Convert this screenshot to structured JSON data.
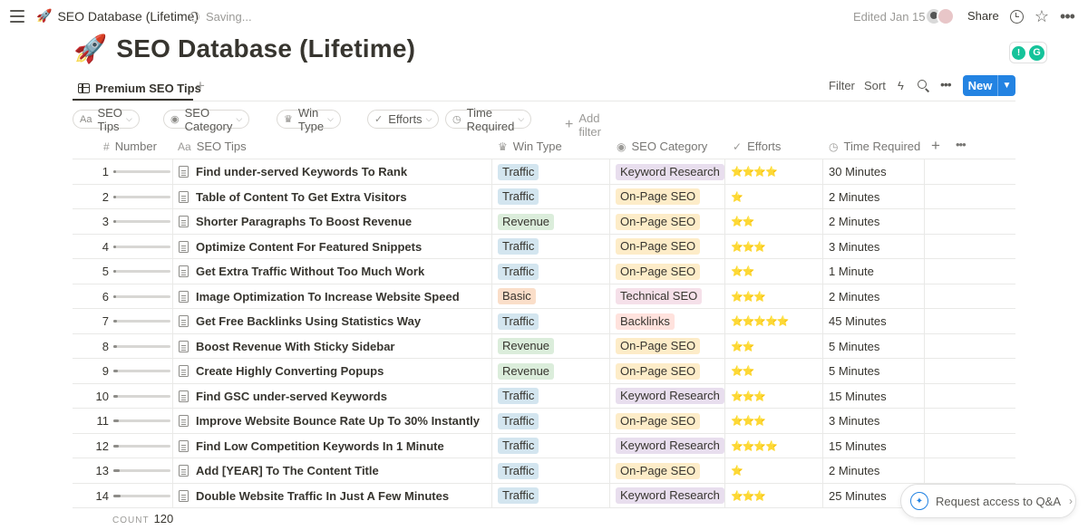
{
  "topbar": {
    "page_emoji": "🚀",
    "breadcrumb": "SEO Database (Lifetime)",
    "saving": "Saving...",
    "edited": "Edited Jan 15",
    "share": "Share"
  },
  "page": {
    "emoji": "🚀",
    "title": "SEO Database (Lifetime)"
  },
  "views": {
    "active_tab": "Premium SEO Tips",
    "filter": "Filter",
    "sort": "Sort",
    "new_label": "New"
  },
  "filters": {
    "chips": [
      "SEO Tips",
      "SEO Category",
      "Win Type",
      "Efforts",
      "Time Required"
    ],
    "add_filter": "Add filter"
  },
  "table": {
    "columns": [
      "Number",
      "SEO Tips",
      "Win Type",
      "SEO Category",
      "Efforts",
      "Time Required"
    ],
    "rows": [
      {
        "num": "1",
        "progress": 0.01,
        "tip": "Find under-served Keywords To Rank",
        "win": "Traffic",
        "cat": "Keyword Research",
        "efforts": "⭐⭐⭐⭐",
        "time": "30 Minutes"
      },
      {
        "num": "2",
        "progress": 0.02,
        "tip": "Table of Content To Get Extra Visitors",
        "win": "Traffic",
        "cat": "On-Page SEO",
        "efforts": "⭐",
        "time": "2 Minutes"
      },
      {
        "num": "3",
        "progress": 0.03,
        "tip": "Shorter Paragraphs To Boost Revenue",
        "win": "Revenue",
        "cat": "On-Page SEO",
        "efforts": "⭐⭐",
        "time": "2 Minutes"
      },
      {
        "num": "4",
        "progress": 0.03,
        "tip": "Optimize Content For Featured Snippets",
        "win": "Traffic",
        "cat": "On-Page SEO",
        "efforts": "⭐⭐⭐",
        "time": "3 Minutes"
      },
      {
        "num": "5",
        "progress": 0.04,
        "tip": "Get Extra Traffic Without Too Much Work",
        "win": "Traffic",
        "cat": "On-Page SEO",
        "efforts": "⭐⭐",
        "time": "1 Minute"
      },
      {
        "num": "6",
        "progress": 0.05,
        "tip": "Image Optimization To Increase Website Speed",
        "win": "Basic",
        "cat": "Technical SEO",
        "efforts": "⭐⭐⭐",
        "time": "2 Minutes"
      },
      {
        "num": "7",
        "progress": 0.06,
        "tip": "Get Free Backlinks Using Statistics Way",
        "win": "Traffic",
        "cat": "Backlinks",
        "efforts": "⭐⭐⭐⭐⭐",
        "time": "45 Minutes"
      },
      {
        "num": "8",
        "progress": 0.07,
        "tip": "Boost Revenue With Sticky Sidebar",
        "win": "Revenue",
        "cat": "On-Page SEO",
        "efforts": "⭐⭐",
        "time": "5 Minutes"
      },
      {
        "num": "9",
        "progress": 0.08,
        "tip": "Create Highly Converting Popups",
        "win": "Revenue",
        "cat": "On-Page SEO",
        "efforts": "⭐⭐",
        "time": "5 Minutes"
      },
      {
        "num": "10",
        "progress": 0.08,
        "tip": "Find GSC under-served Keywords",
        "win": "Traffic",
        "cat": "Keyword Research",
        "efforts": "⭐⭐⭐",
        "time": "15 Minutes"
      },
      {
        "num": "11",
        "progress": 0.09,
        "tip": "Improve Website Bounce Rate Up To 30% Instantly",
        "win": "Traffic",
        "cat": "On-Page SEO",
        "efforts": "⭐⭐⭐",
        "time": "3 Minutes"
      },
      {
        "num": "12",
        "progress": 0.1,
        "tip": "Find Low Competition Keywords In 1 Minute",
        "win": "Traffic",
        "cat": "Keyword Research",
        "efforts": "⭐⭐⭐⭐",
        "time": "15 Minutes"
      },
      {
        "num": "13",
        "progress": 0.11,
        "tip": "Add [YEAR] To The Content Title",
        "win": "Traffic",
        "cat": "On-Page SEO",
        "efforts": "⭐",
        "time": "2 Minutes"
      },
      {
        "num": "14",
        "progress": 0.12,
        "tip": "Double Website Traffic In Just A Few Minutes",
        "win": "Traffic",
        "cat": "Keyword Research",
        "efforts": "⭐⭐⭐",
        "time": "25 Minutes"
      }
    ]
  },
  "footer": {
    "count_label": "COUNT",
    "count": "120"
  },
  "qa": {
    "label": "Request access to Q&A"
  },
  "colors": {
    "accent": "#2383e2",
    "Traffic": "#d3e5ef",
    "Revenue": "#dbeddb",
    "Basic": "#fadec9",
    "Keyword Research": "#e8deee",
    "On-Page SEO": "#fdecc8",
    "Technical SEO": "#f5e0e9",
    "Backlinks": "#ffe2dd"
  }
}
